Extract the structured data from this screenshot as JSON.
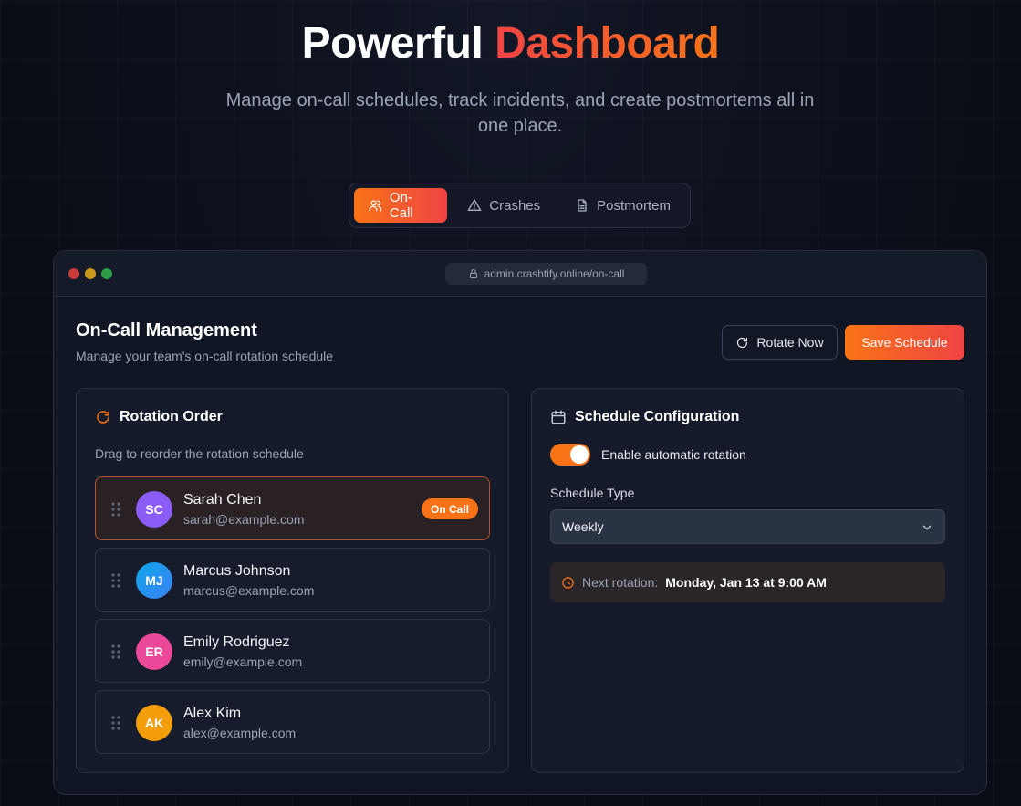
{
  "hero": {
    "title_main": "Powerful",
    "title_accent": "Dashboard",
    "subtitle": "Manage on-call schedules, track incidents, and create postmortems all in one place."
  },
  "tabs": [
    {
      "label": "On-Call",
      "icon": "users-icon",
      "active": true
    },
    {
      "label": "Crashes",
      "icon": "warning-icon",
      "active": false
    },
    {
      "label": "Postmortem",
      "icon": "document-icon",
      "active": false
    }
  ],
  "window": {
    "url": "admin.crashtify.online/on-call"
  },
  "header": {
    "title": "On-Call Management",
    "subtitle": "Manage your team's on-call rotation schedule",
    "rotate_label": "Rotate Now",
    "save_label": "Save Schedule"
  },
  "rotation": {
    "title": "Rotation Order",
    "hint": "Drag to reorder the rotation schedule",
    "badge": "On Call",
    "members": [
      {
        "initials": "SC",
        "name": "Sarah Chen",
        "email": "sarah@example.com",
        "color": "#8b5cf6",
        "on_call": true
      },
      {
        "initials": "MJ",
        "name": "Marcus Johnson",
        "email": "marcus@example.com",
        "color": "#0ea5e9",
        "on_call": false
      },
      {
        "initials": "ER",
        "name": "Emily Rodriguez",
        "email": "emily@example.com",
        "color": "#ec4899",
        "on_call": false
      },
      {
        "initials": "AK",
        "name": "Alex Kim",
        "email": "alex@example.com",
        "color": "#f59e0b",
        "on_call": false
      }
    ]
  },
  "config": {
    "title": "Schedule Configuration",
    "toggle_label": "Enable automatic rotation",
    "toggle_on": true,
    "schedule_type_label": "Schedule Type",
    "schedule_type_value": "Weekly",
    "next_label": "Next rotation:",
    "next_value": "Monday, Jan 13 at 9:00 AM"
  },
  "colors": {
    "accent": "#f97316",
    "accent_end": "#ef4444"
  }
}
